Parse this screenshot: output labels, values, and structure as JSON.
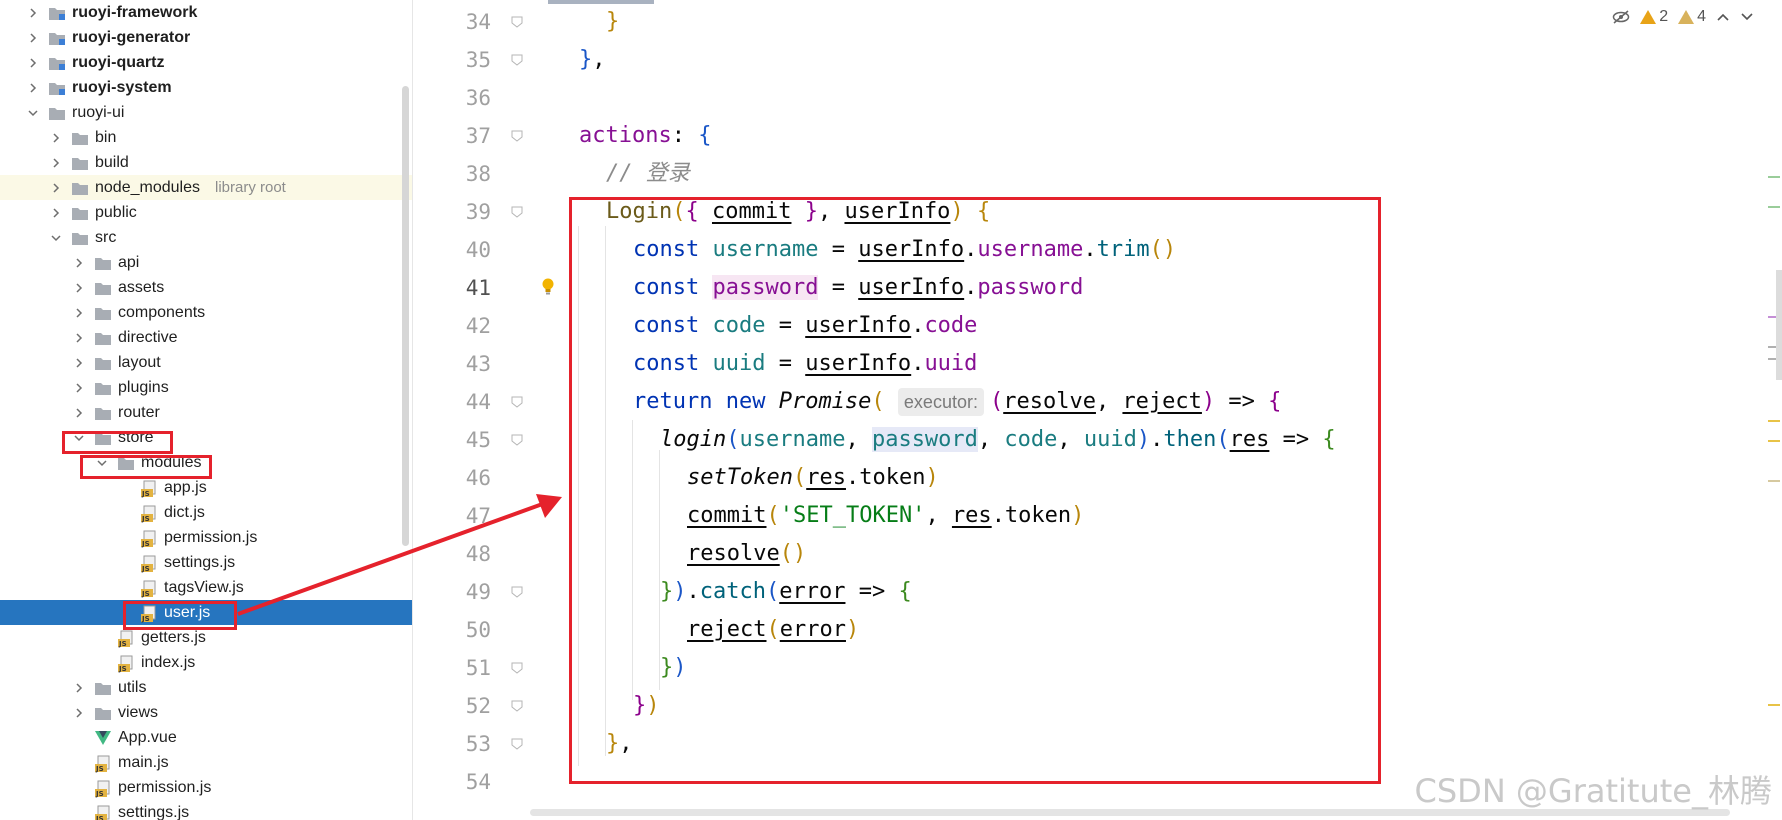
{
  "sidebar": {
    "items": [
      {
        "label": "ruoyi-framework",
        "depth": 0,
        "chevron": "right",
        "icon": "module-folder-icon",
        "bold": true
      },
      {
        "label": "ruoyi-generator",
        "depth": 0,
        "chevron": "right",
        "icon": "module-folder-icon",
        "bold": true
      },
      {
        "label": "ruoyi-quartz",
        "depth": 0,
        "chevron": "right",
        "icon": "module-folder-icon",
        "bold": true
      },
      {
        "label": "ruoyi-system",
        "depth": 0,
        "chevron": "right",
        "icon": "module-folder-icon",
        "bold": true
      },
      {
        "label": "ruoyi-ui",
        "depth": 0,
        "chevron": "down",
        "icon": "folder-icon",
        "bold": false
      },
      {
        "label": "bin",
        "depth": 1,
        "chevron": "right",
        "icon": "folder-icon"
      },
      {
        "label": "build",
        "depth": 1,
        "chevron": "right",
        "icon": "folder-icon"
      },
      {
        "label": "node_modules",
        "depth": 1,
        "chevron": "right",
        "icon": "folder-icon",
        "suffix": "library root",
        "lib": true
      },
      {
        "label": "public",
        "depth": 1,
        "chevron": "right",
        "icon": "folder-icon"
      },
      {
        "label": "src",
        "depth": 1,
        "chevron": "down",
        "icon": "folder-icon"
      },
      {
        "label": "api",
        "depth": 2,
        "chevron": "right",
        "icon": "folder-icon"
      },
      {
        "label": "assets",
        "depth": 2,
        "chevron": "right",
        "icon": "folder-icon"
      },
      {
        "label": "components",
        "depth": 2,
        "chevron": "right",
        "icon": "folder-icon"
      },
      {
        "label": "directive",
        "depth": 2,
        "chevron": "right",
        "icon": "folder-icon"
      },
      {
        "label": "layout",
        "depth": 2,
        "chevron": "right",
        "icon": "folder-icon"
      },
      {
        "label": "plugins",
        "depth": 2,
        "chevron": "right",
        "icon": "folder-icon"
      },
      {
        "label": "router",
        "depth": 2,
        "chevron": "right",
        "icon": "folder-icon"
      },
      {
        "label": "store",
        "depth": 2,
        "chevron": "down",
        "icon": "folder-icon"
      },
      {
        "label": "modules",
        "depth": 3,
        "chevron": "down",
        "icon": "folder-icon"
      },
      {
        "label": "app.js",
        "depth": 4,
        "chevron": "",
        "icon": "js-file-icon"
      },
      {
        "label": "dict.js",
        "depth": 4,
        "chevron": "",
        "icon": "js-file-icon"
      },
      {
        "label": "permission.js",
        "depth": 4,
        "chevron": "",
        "icon": "js-file-icon"
      },
      {
        "label": "settings.js",
        "depth": 4,
        "chevron": "",
        "icon": "js-file-icon"
      },
      {
        "label": "tagsView.js",
        "depth": 4,
        "chevron": "",
        "icon": "js-file-icon"
      },
      {
        "label": "user.js",
        "depth": 4,
        "chevron": "",
        "icon": "js-file-icon",
        "selected": true
      },
      {
        "label": "getters.js",
        "depth": 3,
        "chevron": "",
        "icon": "js-file-icon"
      },
      {
        "label": "index.js",
        "depth": 3,
        "chevron": "",
        "icon": "js-file-icon"
      },
      {
        "label": "utils",
        "depth": 2,
        "chevron": "right",
        "icon": "folder-icon"
      },
      {
        "label": "views",
        "depth": 2,
        "chevron": "right",
        "icon": "folder-icon"
      },
      {
        "label": "App.vue",
        "depth": 2,
        "chevron": "",
        "icon": "vue-file-icon"
      },
      {
        "label": "main.js",
        "depth": 2,
        "chevron": "",
        "icon": "js-file-icon"
      },
      {
        "label": "permission.js",
        "depth": 2,
        "chevron": "",
        "icon": "js-file-icon"
      },
      {
        "label": "settings.js",
        "depth": 2,
        "chevron": "",
        "icon": "js-file-icon"
      }
    ]
  },
  "inspections": {
    "warnings": "2",
    "weak_warnings": "4",
    "warning_icon": "warning-triangle-icon",
    "weak_warning_icon": "weak-warning-triangle-icon",
    "hide_icon": "eye-crossed-icon",
    "prev_icon": "chevron-up-icon",
    "next_icon": "chevron-down-icon"
  },
  "editor": {
    "line_numbers": [
      "34",
      "35",
      "36",
      "37",
      "38",
      "39",
      "40",
      "41",
      "42",
      "43",
      "44",
      "45",
      "46",
      "47",
      "48",
      "49",
      "50",
      "51",
      "52",
      "53",
      "54"
    ],
    "inlay_hint": "executor:",
    "current_line": "41",
    "comment_text": "// 登录",
    "string_literal": "'SET_TOKEN'"
  },
  "watermark": "CSDN @Gratitute_林腾",
  "colors": {
    "selection": "#2675bf",
    "annotation_red": "#e5222c",
    "keyword": "#0033b3",
    "property": "#871094",
    "function": "#00627a"
  }
}
